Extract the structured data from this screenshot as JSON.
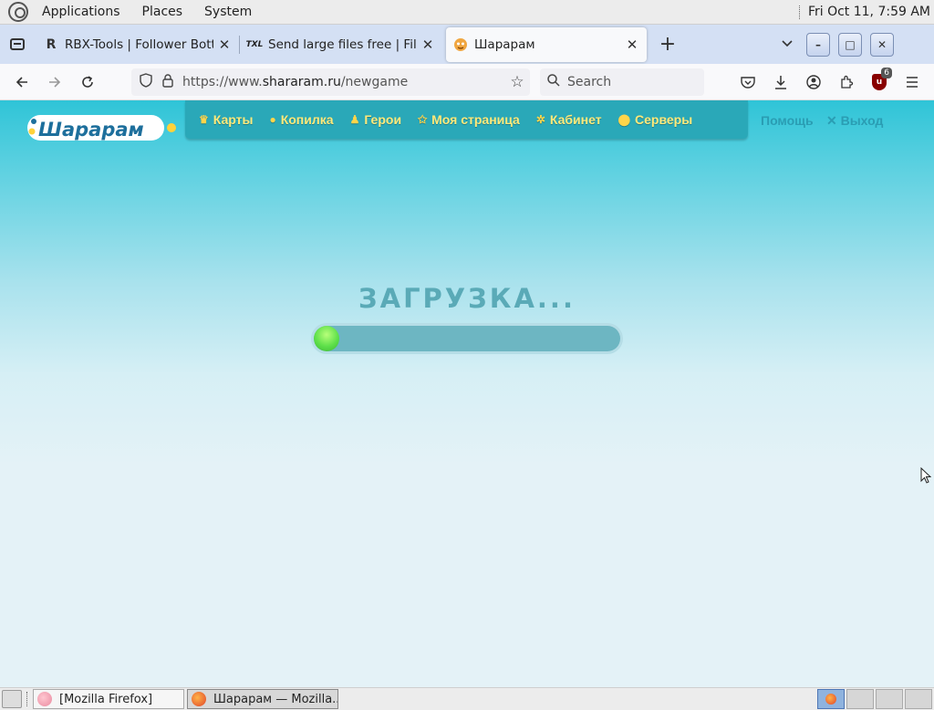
{
  "top_panel": {
    "menus": [
      "Applications",
      "Places",
      "System"
    ],
    "clock": "Fri Oct 11,  7:59 AM"
  },
  "tabs": [
    {
      "favicon": "R",
      "title": "RBX-Tools | Follower Botter",
      "active": false
    },
    {
      "favicon": "TXL",
      "title": "Send large files free | File sh",
      "active": false
    },
    {
      "favicon": "shararam-icon",
      "title": "Шарарам",
      "active": true
    }
  ],
  "window_controls": {
    "minimize": "–",
    "maximize": "□",
    "close": "✕"
  },
  "navbar": {
    "url_prefix": "https://www.",
    "url_domain": "shararam.ru",
    "url_path": "/newgame",
    "search_placeholder": "Search",
    "extension_badge": "6"
  },
  "site": {
    "brand": "Шарарам",
    "nav": [
      {
        "icon": "crown-icon",
        "label": "Карты"
      },
      {
        "icon": "coin-icon",
        "label": "Копилка"
      },
      {
        "icon": "hero-icon",
        "label": "Герои"
      },
      {
        "icon": "star-icon",
        "label": "Моя страница"
      },
      {
        "icon": "gear-icon",
        "label": "Кабинет"
      },
      {
        "icon": "pin-icon",
        "label": "Серверы"
      }
    ],
    "help": "Помощь",
    "exit": "✕ Выход",
    "loading": "ЗАГРУЗКА...",
    "progress": 0.08
  },
  "taskbar": {
    "tasks": [
      {
        "label": "[Mozilla Firefox]",
        "active": false
      },
      {
        "label": "Шарарам — Mozilla...",
        "active": true
      }
    ]
  },
  "colors": {
    "page_top": "#2fc4d7",
    "nav_panel": "#2aa8b8",
    "nav_text": "#ffe97a",
    "progress_fill": "#5fe04a"
  }
}
